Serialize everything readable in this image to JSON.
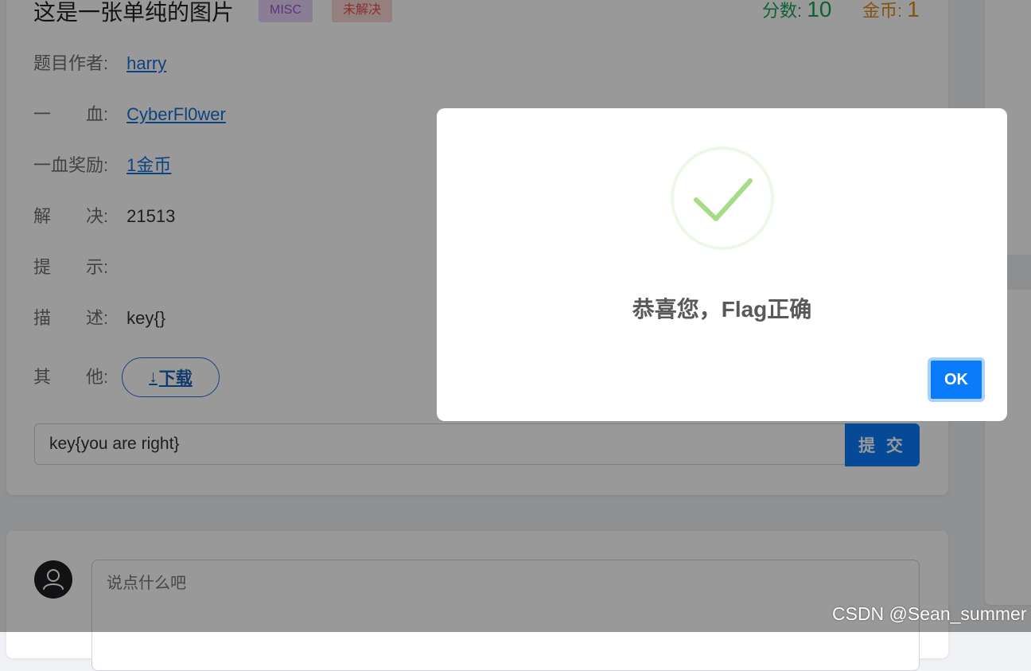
{
  "challenge": {
    "title": "这是一张单纯的图片",
    "category_tag": "MISC",
    "status_tag": "未解决",
    "score_label": "分数:",
    "score_value": "10",
    "coins_label": "金币:",
    "coins_value": "1",
    "details": [
      {
        "label": "题目作者:",
        "value": "harry",
        "is_link": true
      },
      {
        "label": "一　　血:",
        "value": "CyberFl0wer",
        "is_link": true
      },
      {
        "label": "一血奖励:",
        "value": "1金币",
        "is_link": true
      },
      {
        "label": "解　　决:",
        "value": "21513",
        "is_link": false
      },
      {
        "label": "提　　示:",
        "value": "",
        "is_link": false
      },
      {
        "label": "描　　述:",
        "value": "key{}",
        "is_link": false
      },
      {
        "label": "其　　他:",
        "value": "",
        "is_link": false
      }
    ],
    "download_icon": "arrow-down-icon",
    "download_label": "下载",
    "flag_input_value": "key{you are right}",
    "submit_label": "提 交"
  },
  "comment": {
    "avatar_icon": "user-icon",
    "placeholder": "说点什么吧"
  },
  "modal": {
    "icon": "success-check-icon",
    "message": "恭喜您，Flag正确",
    "ok_label": "OK"
  },
  "watermark": "CSDN @Sean_summer",
  "colors": {
    "primary": "#0a7bfa",
    "score": "#1aa25a",
    "coins": "#e08a1e",
    "success_check": "#a5dc86",
    "link": "#1a6fd6"
  }
}
